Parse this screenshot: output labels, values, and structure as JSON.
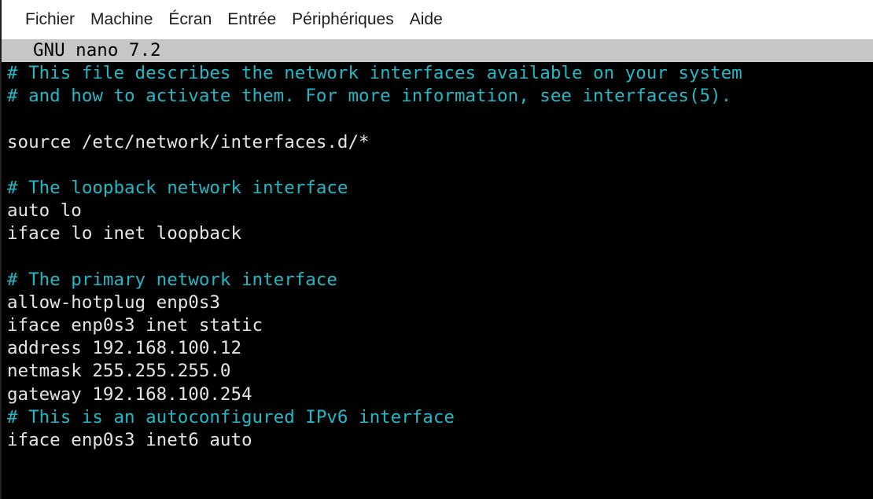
{
  "menubar": {
    "items": [
      {
        "label": "Fichier"
      },
      {
        "label": "Machine"
      },
      {
        "label": "Écran"
      },
      {
        "label": "Entrée"
      },
      {
        "label": "Périphériques"
      },
      {
        "label": "Aide"
      }
    ]
  },
  "nano": {
    "title": "GNU nano 7.2",
    "lines": [
      {
        "text": "# This file describes the network interfaces available on your system",
        "kind": "comment"
      },
      {
        "text": "# and how to activate them. For more information, see interfaces(5).",
        "kind": "comment"
      },
      {
        "text": "",
        "kind": "blank"
      },
      {
        "text": "source /etc/network/interfaces.d/*",
        "kind": "code"
      },
      {
        "text": "",
        "kind": "blank"
      },
      {
        "text": "# The loopback network interface",
        "kind": "comment"
      },
      {
        "text": "auto lo",
        "kind": "code"
      },
      {
        "text": "iface lo inet loopback",
        "kind": "code"
      },
      {
        "text": "",
        "kind": "blank"
      },
      {
        "text": "# The primary network interface",
        "kind": "comment"
      },
      {
        "text": "allow-hotplug enp0s3",
        "kind": "code"
      },
      {
        "text": "iface enp0s3 inet static",
        "kind": "code"
      },
      {
        "text": "address 192.168.100.12",
        "kind": "code"
      },
      {
        "text": "netmask 255.255.255.0",
        "kind": "code"
      },
      {
        "text": "gateway 192.168.100.254",
        "kind": "code"
      },
      {
        "text": "# This is an autoconfigured IPv6 interface",
        "kind": "comment"
      },
      {
        "text": "iface enp0s3 inet6 auto",
        "kind": "code"
      }
    ]
  },
  "colors": {
    "comment": "#22b8c6",
    "text": "#e4e4e4",
    "titlebar_bg": "#c6c6c6",
    "screen_bg": "#000000"
  }
}
